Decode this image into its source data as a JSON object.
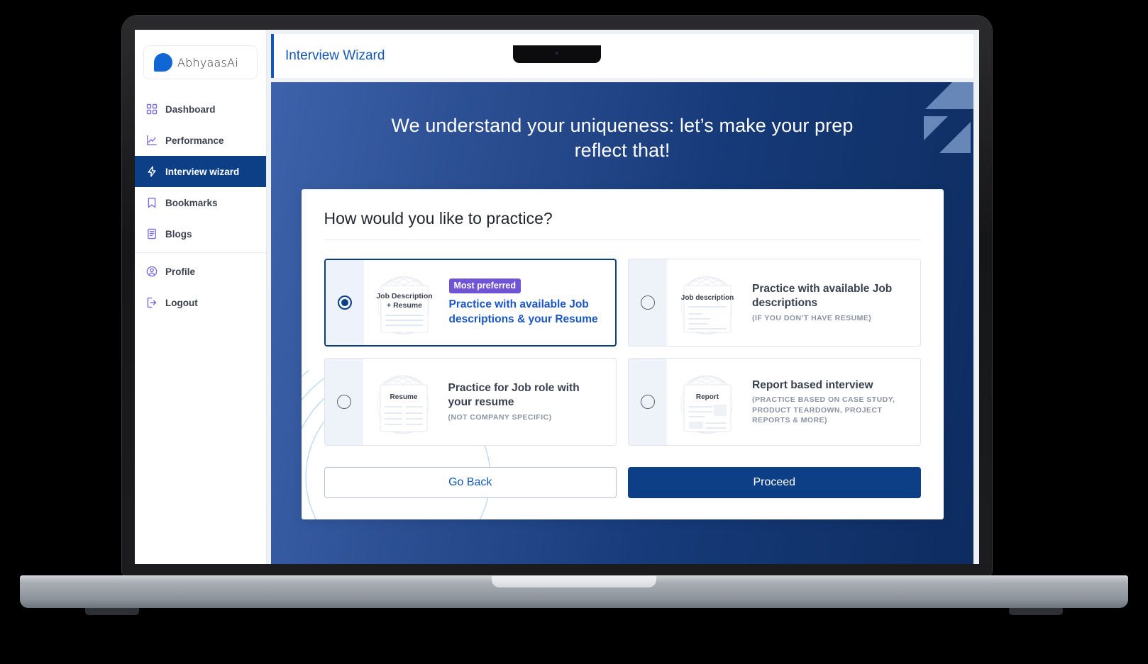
{
  "brand": {
    "logo_text": "AbhyaasAi",
    "logo_icon": "abhyaasai-droplet-logo"
  },
  "sidebar": {
    "items": [
      {
        "label": "Dashboard",
        "icon": "grid-icon",
        "active": false
      },
      {
        "label": "Performance",
        "icon": "chart-line-icon",
        "active": false
      },
      {
        "label": "Interview wizard",
        "icon": "lightning-bolt-icon",
        "active": true
      },
      {
        "label": "Bookmarks",
        "icon": "bookmark-icon",
        "active": false
      },
      {
        "label": "Blogs",
        "icon": "document-icon",
        "active": false
      },
      {
        "label": "Profile",
        "icon": "user-circle-icon",
        "active": false
      },
      {
        "label": "Logout",
        "icon": "logout-icon",
        "active": false
      }
    ]
  },
  "topbar": {
    "title": "Interview Wizard"
  },
  "hero": {
    "heading": "We understand your uniqueness: let’s make your prep reflect that!",
    "decoration_icon": "lightning-bolt-decoration"
  },
  "panel": {
    "heading": "How would you like to practice?",
    "options": [
      {
        "id": "jd-plus-resume",
        "badge": "Most preferred",
        "title": "Practice with available Job descriptions & your Resume",
        "subtitle": "",
        "thumb_label_line1": "Job Description",
        "thumb_label_line2": "+ Resume",
        "thumb_icon": "document-thumbnail-jd-resume",
        "selected": true
      },
      {
        "id": "jd-only",
        "badge": "",
        "title": "Practice with available Job descriptions",
        "subtitle": "(IF YOU DON’T HAVE RESUME)",
        "thumb_label_line1": "Job description",
        "thumb_label_line2": "",
        "thumb_icon": "document-thumbnail-jd",
        "selected": false
      },
      {
        "id": "job-role-resume",
        "badge": "",
        "title": "Practice for Job role with your resume",
        "subtitle": "(NOT COMPANY SPECIFIC)",
        "thumb_label_line1": "Resume",
        "thumb_label_line2": "",
        "thumb_icon": "document-thumbnail-resume",
        "selected": false
      },
      {
        "id": "report-based",
        "badge": "",
        "title": "Report based interview",
        "subtitle": "(PRACTICE BASED ON CASE STUDY, PRODUCT TEARDOWN, PROJECT REPORTS & MORE)",
        "thumb_label_line1": "Report",
        "thumb_label_line2": "",
        "thumb_icon": "document-thumbnail-report",
        "selected": false
      }
    ],
    "go_back_label": "Go Back",
    "proceed_label": "Proceed"
  },
  "colors": {
    "brand_blue": "#1166d6",
    "navy": "#0d3f87",
    "accent_purple": "#6f54d6",
    "icon_violet": "#7b6ddb",
    "link_blue": "#1558b5",
    "hero_gradient_from": "#3e62ab",
    "hero_gradient_to": "#0d2c60"
  }
}
